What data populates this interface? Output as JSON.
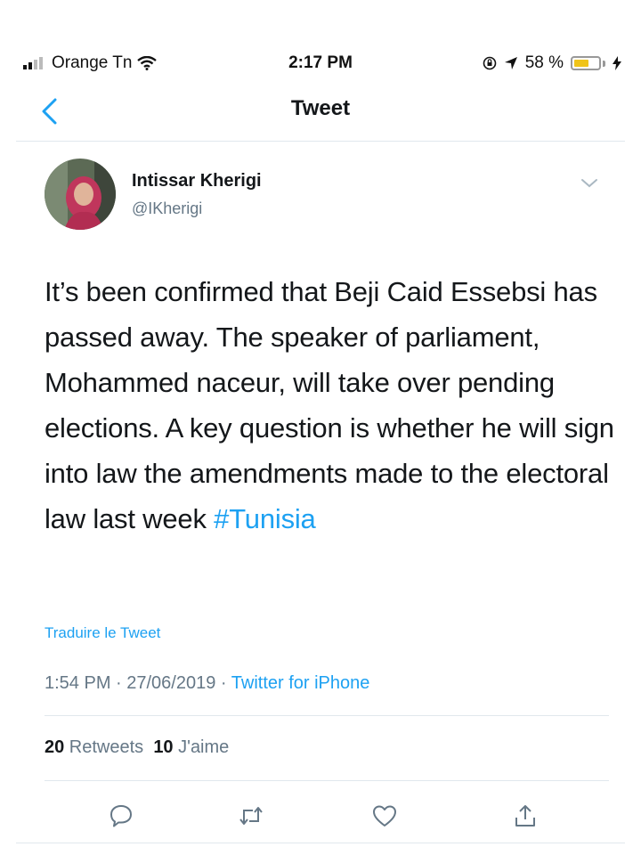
{
  "status_bar": {
    "carrier": "Orange Tn",
    "time": "2:17 PM",
    "battery": "58 %",
    "battery_level": 0.58,
    "signal_icon": "signal-bars-icon",
    "wifi_icon": "wifi-icon",
    "lock_icon": "rotation-lock-icon",
    "location_icon": "location-arrow-icon",
    "charging_icon": "charging-bolt-icon"
  },
  "nav": {
    "back_icon": "chevron-left-icon",
    "title": "Tweet"
  },
  "tweet": {
    "author_name": "Intissar Kherigi",
    "author_handle": "@IKherigi",
    "text": "It’s been confirmed that Beji Caid Essebsi has passed away. The speaker of parliament, Mohammed naceur, will take over pending elections. A key question is whether he will sign into law the amendments made to the electoral law last week ",
    "hashtag": "#Tunisia",
    "translate_label": "Traduire le Tweet",
    "timestamp": "1:54 PM · 27/06/2019 · ",
    "source": "Twitter for iPhone",
    "retweet_count": "20",
    "retweet_label": " Retweets",
    "like_count": "10",
    "like_label": " J'aime"
  },
  "actions": {
    "reply_icon": "reply-icon",
    "retweet_icon": "retweet-icon",
    "like_icon": "heart-icon",
    "share_icon": "share-icon"
  },
  "colors": {
    "link_blue": "#1da1f2",
    "secondary_gray": "#657786",
    "divider": "#e1e8ed",
    "battery_yellow": "#f0c419"
  }
}
